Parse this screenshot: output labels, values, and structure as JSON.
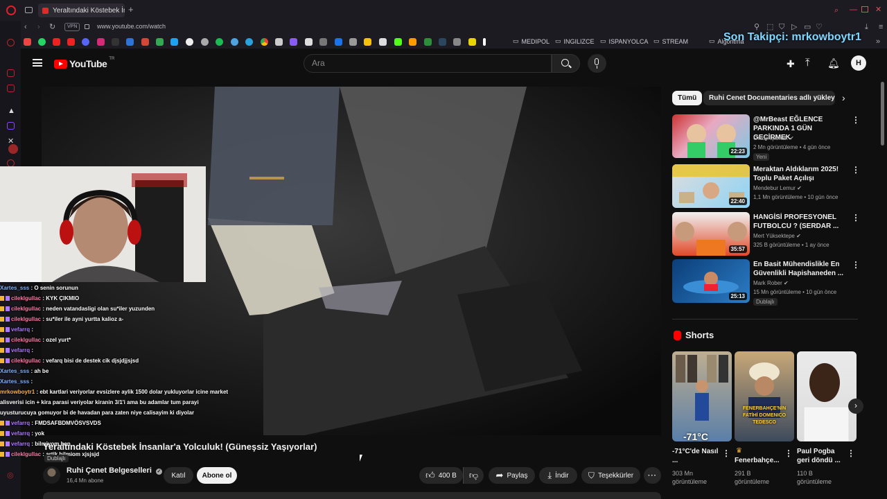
{
  "browser": {
    "tab_title": "Yeraltındaki Köstebek İnsanlar'a Yolculuk! (Güneşsiz Yaşıyorlar)",
    "vpn_label": "VPN",
    "url": "www.youtube.com/watch",
    "bookmark_folders": [
      "MEDIPOL",
      "INGILIZCE",
      "ISPANYOLCA",
      "STREAM",
      "Algoritma"
    ]
  },
  "overlay": {
    "follower_text": "Son Takipçi: mrkowboytr1"
  },
  "youtube": {
    "logo_text": "YouTube",
    "logo_region": "TR",
    "search_placeholder": "Ara",
    "avatar_letter": "H"
  },
  "chat": [
    {
      "user": "Xartes_sss",
      "text": " : O senin sorunun",
      "color": "#7fb2ff",
      "badge": false
    },
    {
      "user": "cileklgullac",
      "text": " : KYK ÇIKMIO",
      "color": "#ff7aa8",
      "badge": true
    },
    {
      "user": "cileklgullac",
      "text": " : neden vatandasligi olan su*iler yuzunden",
      "color": "#ff7aa8",
      "badge": true
    },
    {
      "user": "cileklgullac",
      "text": " : su*iler ile ayni yurtta kalioz a-",
      "color": "#ff7aa8",
      "badge": true
    },
    {
      "user": "vefarrq",
      "text": " : ",
      "color": "#b07aff",
      "badge": true
    },
    {
      "user": "cileklgullac",
      "text": " : ozel yurt*",
      "color": "#ff7aa8",
      "badge": true
    },
    {
      "user": "vefarrq",
      "text": " : ",
      "color": "#b07aff",
      "badge": true
    },
    {
      "user": "cileklgullac",
      "text": " : vefarq bisi de destek cik djsjdjjsjsd",
      "color": "#ff7aa8",
      "badge": true
    },
    {
      "user": "Xartes_sss",
      "text": " : ah be",
      "color": "#7fb2ff",
      "badge": false
    },
    {
      "user": "Xartes_sss",
      "text": " : ",
      "color": "#7fb2ff",
      "badge": false
    },
    {
      "user": "mrkowboytr1",
      "text": " : ebt kartlari veriyorlar evsizlere aylik 1500 dolar yukluyorlar icine market",
      "color": "#ffb347",
      "badge": false
    },
    {
      "user": "",
      "text": "alisverisi icin + kira parasi veriyolar kiranin 3/1'i ama bu adamlar tum parayi",
      "color": "#ffffff",
      "badge": false
    },
    {
      "user": "",
      "text": "uyusturucuya gomuyor bi de havadan para zaten niye calisayim ki diyolar",
      "color": "#ffffff",
      "badge": false
    },
    {
      "user": "vefarrq",
      "text": " : FMDSAFBDMVÖSVSVDS",
      "color": "#b07aff",
      "badge": true
    },
    {
      "user": "vefarrq",
      "text": " : yok",
      "color": "#b07aff",
      "badge": true
    },
    {
      "user": "vefarrq",
      "text": " : bilmiyom ben",
      "color": "#b07aff",
      "badge": true
    },
    {
      "user": "cileklgullac",
      "text": " : artik bilmiom xjsjsjd",
      "color": "#ff7aa8",
      "badge": true
    }
  ],
  "video": {
    "title": "Yeraltındaki Köstebek İnsanlar'a Yolculuk! (Güneşsiz Yaşıyorlar)",
    "dub_label": "Dublajlı",
    "channel_name": "Ruhi Çenet Belgeselleri",
    "subscribers": "16,4 Mn abone",
    "join_label": "Katıl",
    "subscribe_label": "Abone ol",
    "likes": "400 B",
    "share_label": "Paylaş",
    "download_label": "İndir",
    "thanks_label": "Teşekkürler"
  },
  "sidebar": {
    "chips": [
      "Tümü",
      "Ruhi Cenet Documentaries adlı yükleyiciden"
    ],
    "recommendations": [
      {
        "title": "@MrBeast  EĞLENCE PARKINDA 1 GÜN GEÇİRMEK",
        "channel": "Orkun Işıtmak",
        "meta": "2 Mn görüntüleme • 4 gün önce",
        "duration": "22:23",
        "badge": "Yeni"
      },
      {
        "title": "Meraktan Aldıklarım 2025! Toplu Paket Açılışı",
        "channel": "Mendebur Lemur",
        "meta": "1,1 Mn görüntüleme • 10 gün önce",
        "duration": "22:40",
        "badge": ""
      },
      {
        "title": "HANGİSİ PROFESYONEL FUTBOLCU ? (SERDAR ...",
        "channel": "Mert Yüksektepe",
        "meta": "325 B görüntüleme • 1 ay önce",
        "duration": "35:57",
        "badge": ""
      },
      {
        "title": "En Basit Mühendislikle En Güvenlikli Hapishaneden ...",
        "channel": "Mark Rober",
        "meta": "15 Mn görüntüleme • 10 gün önce",
        "duration": "25:13",
        "badge": "Dublajlı"
      }
    ],
    "shorts_heading": "Shorts",
    "shorts": [
      {
        "title": "-71°C'de Nasıl ...",
        "views": "303 Mn görüntüleme",
        "thumb_text": "-71°C"
      },
      {
        "title": "Fenerbahçe...",
        "views": "291 B görüntüleme",
        "thumb_text": "FENERBAHÇE'NİN FATİHİ DOMENICO TEDESCO"
      },
      {
        "title": "Paul Pogba geri döndü ...",
        "views": "110 B görüntüleme",
        "thumb_text": ""
      }
    ]
  }
}
